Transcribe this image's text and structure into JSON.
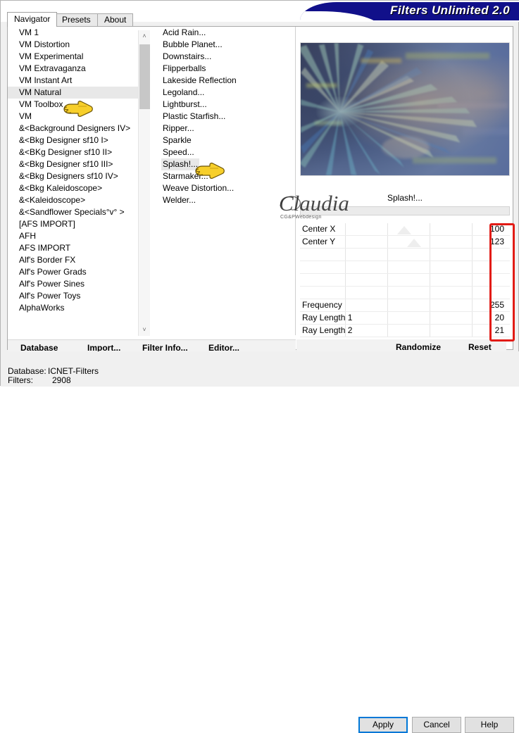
{
  "window": {
    "title": "Filters Unlimited 2.0"
  },
  "tabs": [
    {
      "label": "Navigator",
      "active": true
    },
    {
      "label": "Presets",
      "active": false
    },
    {
      "label": "About",
      "active": false
    }
  ],
  "categories": {
    "selected": "VM Natural",
    "items": [
      "VM 1",
      "VM Distortion",
      "VM Experimental",
      "VM Extravaganza",
      "VM Instant Art",
      "VM Natural",
      "VM Toolbox",
      "VM",
      "&<Background Designers IV>",
      "&<Bkg Designer sf10 I>",
      "&<BKg Designer sf10 II>",
      "&<Bkg Designer sf10 III>",
      "&<Bkg Designers sf10 IV>",
      "&<Bkg Kaleidoscope>",
      "&<Kaleidoscope>",
      "&<Sandflower Specials°v° >",
      "[AFS IMPORT]",
      "AFH",
      "AFS IMPORT",
      "Alf's Border FX",
      "Alf's Power Grads",
      "Alf's Power Sines",
      "Alf's Power Toys",
      "AlphaWorks"
    ]
  },
  "filters": {
    "selected": "Splash!...",
    "items": [
      "Acid Rain...",
      "Bubble Planet...",
      "Downstairs...",
      "Flipperballs",
      "Lakeside Reflection",
      "Legoland...",
      "Lightburst...",
      "Plastic Starfish...",
      "Ripper...",
      "Sparkle",
      "Speed...",
      "Splash!...",
      "Starmaker...",
      "Weave Distortion...",
      "Welder..."
    ]
  },
  "preview": {
    "filter_name": "Splash!..."
  },
  "watermark": {
    "name": "Claudia",
    "subtitle": "CG&PWebdesign"
  },
  "parameters": [
    {
      "label": "Center X",
      "value": "100",
      "slider": 0.46,
      "row": 0
    },
    {
      "label": "Center Y",
      "value": "123",
      "slider": 0.54,
      "row": 1
    },
    {
      "label": "",
      "value": "",
      "slider": null,
      "row": 2
    },
    {
      "label": "",
      "value": "",
      "slider": null,
      "row": 3
    },
    {
      "label": "",
      "value": "",
      "slider": null,
      "row": 4
    },
    {
      "label": "",
      "value": "",
      "slider": null,
      "row": 5
    },
    {
      "label": "Frequency",
      "value": "255",
      "slider": null,
      "row": 6
    },
    {
      "label": "Ray Length 1",
      "value": "20",
      "slider": null,
      "row": 7
    },
    {
      "label": "Ray Length 2",
      "value": "21",
      "slider": null,
      "row": 8
    }
  ],
  "actions": {
    "database": "Database",
    "import": "Import...",
    "filter_info": "Filter Info...",
    "editor": "Editor...",
    "randomize": "Randomize",
    "reset": "Reset"
  },
  "status": {
    "database_label": "Database:",
    "database_value": "ICNET-Filters",
    "filters_label": "Filters:",
    "filters_value": "2908"
  },
  "dialog_buttons": {
    "apply": "Apply",
    "cancel": "Cancel",
    "help": "Help"
  },
  "annotation": {
    "highlight_color": "#e21b15"
  },
  "icons": {
    "scroll_up": "˄",
    "scroll_down": "˅"
  }
}
